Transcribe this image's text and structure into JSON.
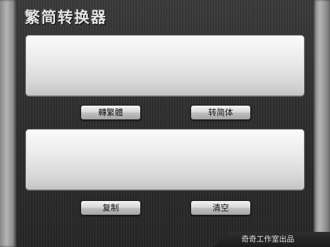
{
  "app": {
    "title": "繁简转换器"
  },
  "input": {
    "value": "",
    "placeholder": ""
  },
  "output": {
    "value": "",
    "placeholder": ""
  },
  "buttons": {
    "to_traditional": "轉繁體",
    "to_simplified": "转简体",
    "copy": "复制",
    "clear": "清空"
  },
  "footer": {
    "credit": "奇奇工作室出品"
  },
  "colors": {
    "background": "#2e2e2e",
    "metal_frame": "#a8a8a8",
    "title_text": "#e6e6e6",
    "textbox_light": "#f4f4f4",
    "textbox_dark": "#c4c4c4"
  }
}
